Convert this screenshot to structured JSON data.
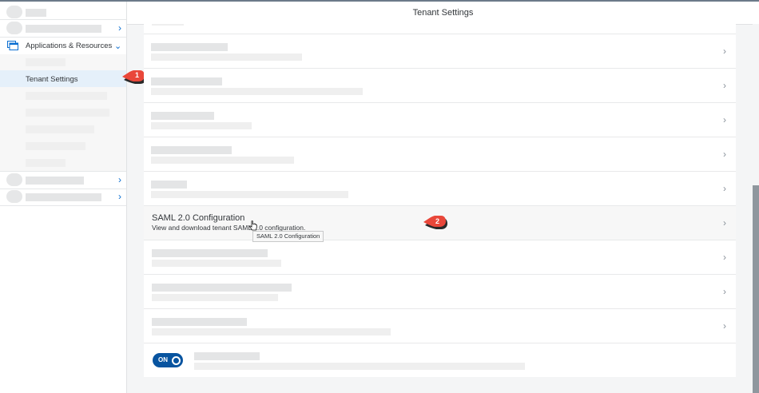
{
  "header": {
    "title": "Tenant Settings"
  },
  "sidebar": {
    "group_label": "Applications & Resources",
    "selected_item": "Tenant Settings"
  },
  "saml": {
    "title": "SAML 2.0 Configuration",
    "description": "View and download tenant SAML 2.0 configuration.",
    "tooltip": "SAML 2.0 Configuration"
  },
  "toggle": {
    "label": "ON"
  },
  "callouts": {
    "one": "1",
    "two": "2"
  },
  "colors": {
    "accent": "#0a6ed1",
    "toggle": "#0854a0",
    "callout": "#e9473a"
  }
}
